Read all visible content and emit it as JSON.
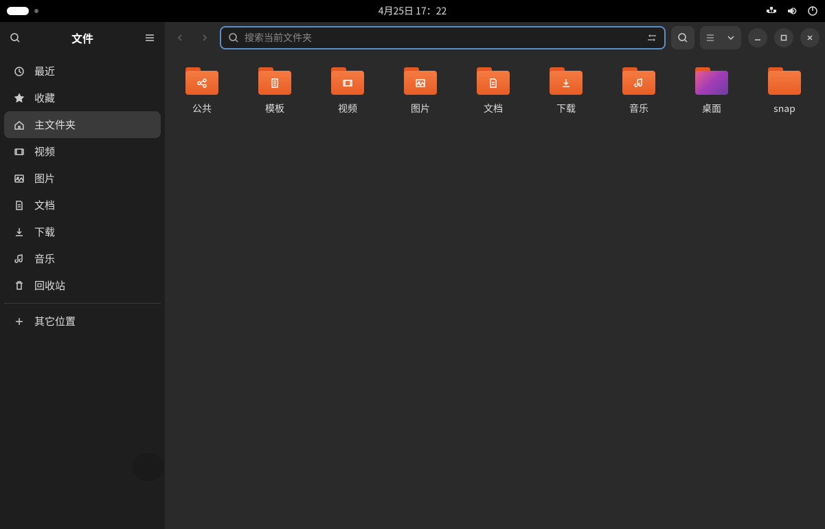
{
  "topbar": {
    "datetime": "4月25日  17：22"
  },
  "sidebar": {
    "title": "文件",
    "items": [
      {
        "icon": "clock",
        "label": "最近"
      },
      {
        "icon": "star",
        "label": "收藏"
      },
      {
        "icon": "home",
        "label": "主文件夹",
        "active": true
      },
      {
        "icon": "video",
        "label": "视频"
      },
      {
        "icon": "image",
        "label": "图片"
      },
      {
        "icon": "doc",
        "label": "文档"
      },
      {
        "icon": "download",
        "label": "下载"
      },
      {
        "icon": "music",
        "label": "音乐"
      },
      {
        "icon": "trash",
        "label": "回收站"
      }
    ],
    "other": {
      "label": "其它位置"
    }
  },
  "toolbar": {
    "search_placeholder": "搜索当前文件夹"
  },
  "folders": [
    {
      "icon": "share",
      "label": "公共"
    },
    {
      "icon": "template",
      "label": "模板"
    },
    {
      "icon": "video",
      "label": "视频"
    },
    {
      "icon": "image",
      "label": "图片"
    },
    {
      "icon": "doc",
      "label": "文档"
    },
    {
      "icon": "download",
      "label": "下载"
    },
    {
      "icon": "music",
      "label": "音乐"
    },
    {
      "icon": "desktop",
      "label": "桌面",
      "style": "desktop"
    },
    {
      "icon": "plain",
      "label": "snap",
      "style": "plain"
    }
  ]
}
